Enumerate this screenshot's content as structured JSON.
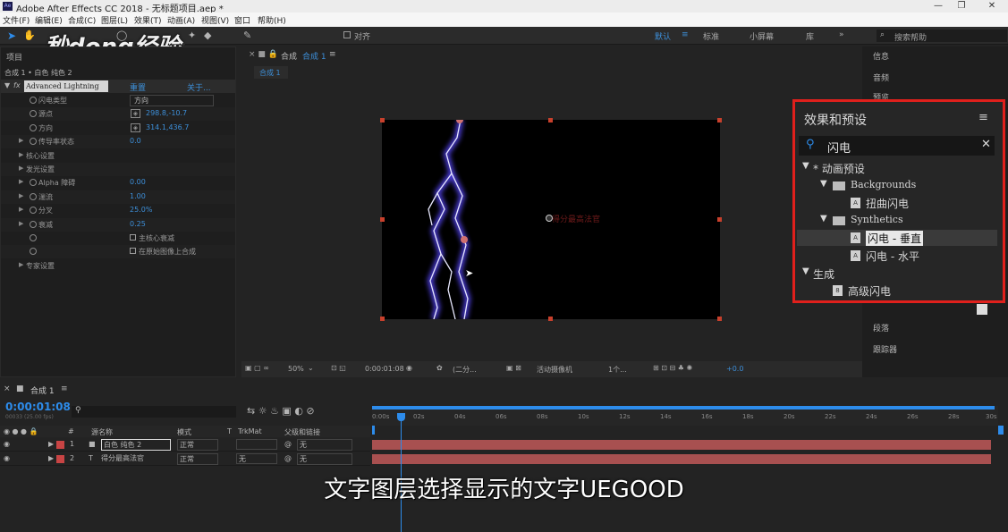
{
  "app": {
    "title": "Adobe After Effects CC 2018 - 无标题项目.aep *",
    "logo": "Ae"
  },
  "window_controls": {
    "minimize": "—",
    "restore": "❐",
    "close": "✕"
  },
  "menu": [
    "文件(F)",
    "编辑(E)",
    "合成(C)",
    "图层(L)",
    "效果(T)",
    "动画(A)",
    "视图(V)",
    "窗口",
    "帮助(H)"
  ],
  "toolbar": {
    "align": "对齐",
    "workspaces": [
      "默认",
      "标准",
      "小屏幕",
      "库"
    ],
    "more": "»",
    "search_placeholder": "搜索帮助"
  },
  "watermark": "秒dong经验",
  "effect_controls": {
    "tab": "项目",
    "breadcrumb": "合成 1 • 白色 纯色 2",
    "fx_name": "Advanced Lightning",
    "reset": "重置",
    "about": "关于...",
    "props": [
      {
        "label": "闪电类型",
        "value": "方向",
        "type": "dropdown"
      },
      {
        "label": "源点",
        "value": "298.8,-10.7",
        "type": "point"
      },
      {
        "label": "方向",
        "value": "314.1,436.7",
        "type": "point"
      },
      {
        "label": "传导率状态",
        "value": "0.0",
        "type": "num",
        "expand": true
      },
      {
        "label": "核心设置",
        "value": "",
        "type": "group",
        "expand": true
      },
      {
        "label": "发光设置",
        "value": "",
        "type": "group",
        "expand": true
      },
      {
        "label": "Alpha 障碍",
        "value": "0.00",
        "type": "num",
        "expand": true
      },
      {
        "label": "湍流",
        "value": "1.00",
        "type": "num",
        "expand": true
      },
      {
        "label": "分叉",
        "value": "25.0%",
        "type": "num",
        "expand": true
      },
      {
        "label": "衰减",
        "value": "0.25",
        "type": "num",
        "expand": true
      },
      {
        "label": "主核心衰减",
        "value": "",
        "type": "check"
      },
      {
        "label": "在原始图像上合成",
        "value": "",
        "type": "check"
      },
      {
        "label": "专家设置",
        "value": "",
        "type": "group",
        "expand": true
      }
    ]
  },
  "composition": {
    "tab_prefix": "合成",
    "tab": "合成 1",
    "sub_tab": "合成 1",
    "layer_text": "得分最高法官"
  },
  "viewer_bar": {
    "zoom": "50%",
    "timecode": "0:00:01:08",
    "resolution": "(二分...",
    "camera": "活动摄像机",
    "views": "1个...",
    "exposure": "+0.0"
  },
  "right_panel": {
    "items_top": [
      "信息",
      "音频",
      "预览"
    ],
    "items_bottom": [
      "段落",
      "跟踪器"
    ]
  },
  "effects_presets": {
    "title": "效果和预设",
    "search": "闪电",
    "tree": [
      {
        "label": "* 动画预设",
        "level": 0,
        "kind": "folder-open"
      },
      {
        "label": "Backgrounds",
        "level": 1,
        "kind": "folder"
      },
      {
        "label": "扭曲闪电",
        "level": 2,
        "kind": "preset"
      },
      {
        "label": "Synthetics",
        "level": 1,
        "kind": "folder"
      },
      {
        "label": "闪电 - 垂直",
        "level": 2,
        "kind": "preset",
        "selected": true
      },
      {
        "label": "闪电 - 水平",
        "level": 2,
        "kind": "preset"
      },
      {
        "label": "生成",
        "level": 0,
        "kind": "folder-open"
      },
      {
        "label": "高级闪电",
        "level": 1,
        "kind": "effect"
      }
    ]
  },
  "timeline": {
    "tab": "合成 1",
    "timecode": "0:00:01:08",
    "fps": "00033 (25.00 fps)",
    "headers": {
      "source": "源名称",
      "mode": "模式",
      "t": "T",
      "trkmat": "TrkMat",
      "parent": "父级和链接"
    },
    "layers": [
      {
        "num": "1",
        "name": "白色 纯色 2",
        "mode": "正常",
        "trkmat": "",
        "parent": "无",
        "color": "#c84444"
      },
      {
        "num": "2",
        "name": "得分最高法官",
        "mode": "正常",
        "trkmat": "无",
        "parent": "无",
        "color": "#c84444"
      }
    ],
    "ruler": [
      "0:00s",
      "02s",
      "04s",
      "06s",
      "08s",
      "10s",
      "12s",
      "14s",
      "16s",
      "18s",
      "20s",
      "22s",
      "24s",
      "26s",
      "28s",
      "30s"
    ]
  },
  "subtitle": "文字图层选择显示的文字UEGOOD",
  "colors": {
    "accent": "#2d8ceb",
    "highlight": "#e0201c",
    "layer_bar": "#a85050"
  }
}
